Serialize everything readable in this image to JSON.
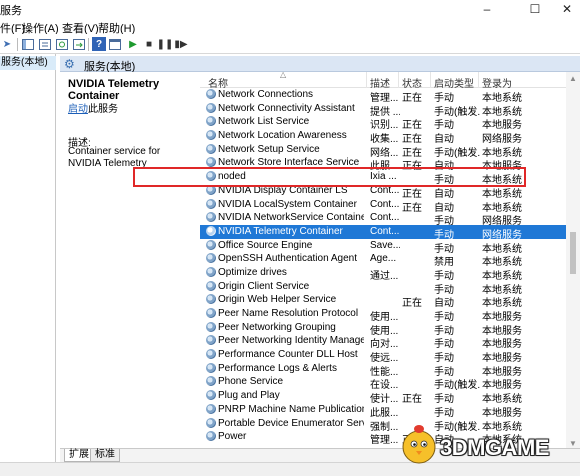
{
  "window": {
    "title": "服务"
  },
  "menu": [
    "件(F)",
    "操作(A)",
    "查看(V)",
    "帮助(H)"
  ],
  "left_pane": {
    "node_label": "服务(本地)"
  },
  "pane_header": "服务(本地)",
  "details": {
    "service_name": "NVIDIA Telemetry Container",
    "start_link": "启动",
    "start_suffix": "此服务",
    "desc_label": "描述:",
    "desc_text": "Container service for NVIDIA Telemetry"
  },
  "columns": {
    "name": "名称",
    "desc": "描述",
    "status": "状态",
    "startup": "启动类型",
    "logon": "登录为"
  },
  "services": [
    {
      "name": "Network Connections",
      "desc": "管理...",
      "status": "正在",
      "startup": "手动",
      "logon": "本地系统"
    },
    {
      "name": "Network Connectivity Assistant",
      "desc": "提供 ...",
      "status": "",
      "startup": "手动(触发...",
      "logon": "本地系统"
    },
    {
      "name": "Network List Service",
      "desc": "识别...",
      "status": "正在",
      "startup": "手动",
      "logon": "本地服务"
    },
    {
      "name": "Network Location Awareness",
      "desc": "收集...",
      "status": "正在",
      "startup": "自动",
      "logon": "网络服务"
    },
    {
      "name": "Network Setup Service",
      "desc": "网络...",
      "status": "正在",
      "startup": "手动(触发...",
      "logon": "本地系统"
    },
    {
      "name": "Network Store Interface Service",
      "desc": "此服...",
      "status": "正在",
      "startup": "自动",
      "logon": "本地服务"
    },
    {
      "name": "noded",
      "desc": "Ixia ...",
      "status": "",
      "startup": "手动",
      "logon": "本地系统"
    },
    {
      "name": "NVIDIA Display Container LS",
      "desc": "Cont...",
      "status": "正在",
      "startup": "自动",
      "logon": "本地系统"
    },
    {
      "name": "NVIDIA LocalSystem Container",
      "desc": "Cont...",
      "status": "正在",
      "startup": "自动",
      "logon": "本地系统"
    },
    {
      "name": "NVIDIA NetworkService Container",
      "desc": "Cont...",
      "status": "",
      "startup": "手动",
      "logon": "网络服务"
    },
    {
      "name": "NVIDIA Telemetry Container",
      "desc": "Cont...",
      "status": "",
      "startup": "手动",
      "logon": "网络服务"
    },
    {
      "name": "Office  Source Engine",
      "desc": "Save...",
      "status": "",
      "startup": "手动",
      "logon": "本地系统"
    },
    {
      "name": "OpenSSH Authentication Agent",
      "desc": "Age...",
      "status": "",
      "startup": "禁用",
      "logon": "本地系统"
    },
    {
      "name": "Optimize drives",
      "desc": "通过...",
      "status": "",
      "startup": "手动",
      "logon": "本地系统"
    },
    {
      "name": "Origin Client Service",
      "desc": "",
      "status": "",
      "startup": "手动",
      "logon": "本地系统"
    },
    {
      "name": "Origin Web Helper Service",
      "desc": "",
      "status": "正在",
      "startup": "自动",
      "logon": "本地系统"
    },
    {
      "name": "Peer Name Resolution Protocol",
      "desc": "使用...",
      "status": "",
      "startup": "手动",
      "logon": "本地服务"
    },
    {
      "name": "Peer Networking Grouping",
      "desc": "使用...",
      "status": "",
      "startup": "手动",
      "logon": "本地服务"
    },
    {
      "name": "Peer Networking Identity Manager",
      "desc": "向对...",
      "status": "",
      "startup": "手动",
      "logon": "本地服务"
    },
    {
      "name": "Performance Counter DLL Host",
      "desc": "使远...",
      "status": "",
      "startup": "手动",
      "logon": "本地服务"
    },
    {
      "name": "Performance Logs & Alerts",
      "desc": "性能...",
      "status": "",
      "startup": "手动",
      "logon": "本地服务"
    },
    {
      "name": "Phone Service",
      "desc": "在设...",
      "status": "",
      "startup": "手动(触发...",
      "logon": "本地服务"
    },
    {
      "name": "Plug and Play",
      "desc": "使计...",
      "status": "正在",
      "startup": "手动",
      "logon": "本地系统"
    },
    {
      "name": "PNRP Machine Name Publication Ser...",
      "desc": "此服...",
      "status": "",
      "startup": "手动",
      "logon": "本地服务"
    },
    {
      "name": "Portable Device Enumerator Service",
      "desc": "强制...",
      "status": "",
      "startup": "手动(触发...",
      "logon": "本地系统"
    },
    {
      "name": "Power",
      "desc": "管理...",
      "status": "正在",
      "startup": "自动",
      "logon": "本地系统"
    }
  ],
  "selected_index": 10,
  "tabs": {
    "extended": "扩展",
    "standard": "标准"
  },
  "watermark": {
    "text": "3DMGAME"
  },
  "colors": {
    "selection": "#1f78d6",
    "highlight_box": "#e02828",
    "pane_header": "#dbe6f4"
  }
}
